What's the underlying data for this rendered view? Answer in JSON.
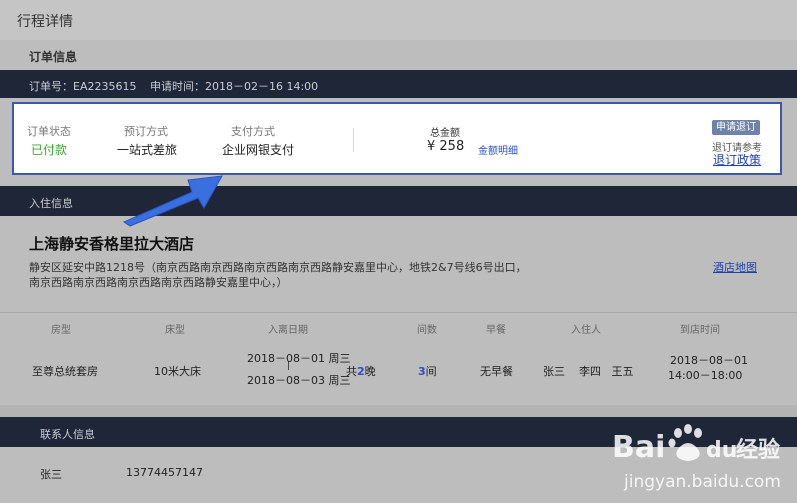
{
  "page_title": "行程详情",
  "order_section": {
    "heading": "订单信息",
    "order_no_label": "订单号：EA2235615",
    "apply_time_label": "申请时间：2018－02－16  14:00",
    "status_label": "订单状态",
    "status_value": "已付款",
    "booking_label": "预订方式",
    "booking_value": "一站式差旅",
    "payment_label": "支付方式",
    "payment_value": "企业网银支付",
    "total_label": "总金额",
    "total_value": "¥ 258",
    "detail_link": "金额明细",
    "refund_button": "申请退订",
    "refund_note": "退订请参考",
    "refund_policy_link": "退订政策"
  },
  "checkin_section": {
    "heading": "入住信息",
    "hotel_name": "上海静安香格里拉大酒店",
    "address_line1": "静安区延安中路1218号（南京西路南京西路南京西路南京西路静安嘉里中心，地铁2&7号线6号出口，",
    "address_line2": "南京西路南京西路南京西路南京西路静安嘉里中心，）",
    "map_link": "酒店地图",
    "columns": [
      "房型",
      "床型",
      "入离日期",
      "间数",
      "早餐",
      "入住人",
      "到店时间"
    ],
    "row": {
      "room_type": "至尊总统套房",
      "bed_type": "10米大床",
      "date_in": "2018－08－01  周三",
      "date_sep": "|",
      "date_out": "2018－08－03  周三",
      "nights_prefix": "共",
      "nights_num": "2",
      "nights_suffix": "晚",
      "rooms_num": "3",
      "rooms_suffix": "间",
      "breakfast": "无早餐",
      "guests": "张三    李四   王五",
      "arrival_date": "2018－08－01",
      "arrival_time": "14:00－18:00"
    }
  },
  "contact_section": {
    "heading": "联系人信息",
    "name": "张三",
    "phone": "13774457147"
  },
  "watermark": {
    "brand": "Bai",
    "brand2": "du",
    "cn": "经验",
    "url": "jingyan.baidu.com"
  },
  "colors": {
    "dark_bar": "#1f2637",
    "accent_blue": "#2b4fc9",
    "status_green": "#3aa82f",
    "arrow_blue": "#3a6fe0"
  }
}
